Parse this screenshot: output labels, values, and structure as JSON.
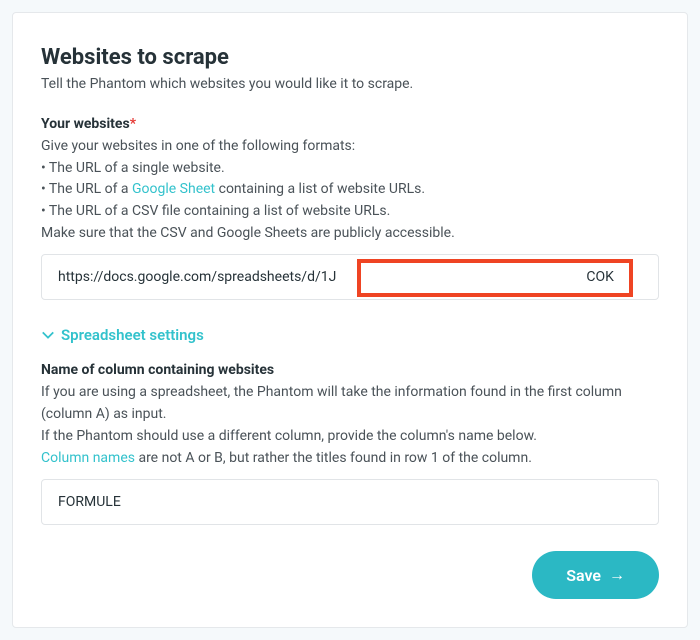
{
  "header": {
    "title": "Websites to scrape",
    "subtitle": "Tell the Phantom which websites you would like it to scrape."
  },
  "websites": {
    "label": "Your websites",
    "required_marker": "*",
    "help_intro": "Give your websites in one of the following formats:",
    "bullet1": "• The URL of a single website.",
    "bullet2_prefix": "• The URL of a ",
    "bullet2_link": "Google Sheet",
    "bullet2_suffix": " containing a list of website URLs.",
    "bullet3": "• The URL of a CSV file containing a list of website URLs.",
    "help_footer": "Make sure that the CSV and Google Sheets are publicly accessible.",
    "input_value": "https://docs.google.com/spreadsheets/d/1J                                                                        COK"
  },
  "expander": {
    "label": "Spreadsheet settings"
  },
  "column": {
    "label": "Name of column containing websites",
    "help1": "If you are using a spreadsheet, the Phantom will take the information found in the first column (column A) as input.",
    "help2": "If the Phantom should use a different column, provide the column's name below.",
    "help3_link": "Column names",
    "help3_suffix": " are not A or B, but rather the titles found in row 1 of the column.",
    "input_value": "FORMULE"
  },
  "actions": {
    "save_label": "Save"
  }
}
